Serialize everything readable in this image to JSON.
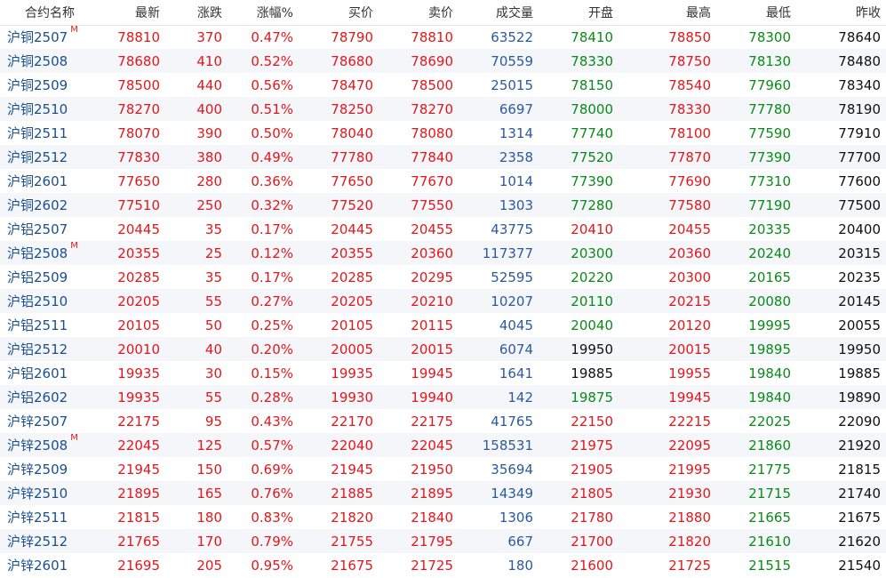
{
  "colors": {
    "up": "#e5161b",
    "down": "#098b17",
    "flat": "#111111",
    "volume": "#2b5a9c",
    "name": "#1a4f8f",
    "main_mark": "#e02020",
    "row_stripe": "#f4f6fa"
  },
  "headers": [
    "合约名称",
    "最新",
    "涨跌",
    "涨幅%",
    "买价",
    "卖价",
    "成交量",
    "开盘",
    "最高",
    "最低",
    "昨收"
  ],
  "rows": [
    {
      "name": "沪铜2507",
      "main": "M",
      "last": "78810",
      "chg": "370",
      "pct": "0.47%",
      "bid": "78790",
      "ask": "78810",
      "vol": "63522",
      "open": "78410",
      "high": "78850",
      "low": "78300",
      "prev": "78640"
    },
    {
      "name": "沪铜2508",
      "main": "",
      "last": "78680",
      "chg": "410",
      "pct": "0.52%",
      "bid": "78680",
      "ask": "78690",
      "vol": "70559",
      "open": "78330",
      "high": "78750",
      "low": "78130",
      "prev": "78480"
    },
    {
      "name": "沪铜2509",
      "main": "",
      "last": "78500",
      "chg": "440",
      "pct": "0.56%",
      "bid": "78470",
      "ask": "78500",
      "vol": "25015",
      "open": "78150",
      "high": "78540",
      "low": "77960",
      "prev": "78340"
    },
    {
      "name": "沪铜2510",
      "main": "",
      "last": "78270",
      "chg": "400",
      "pct": "0.51%",
      "bid": "78250",
      "ask": "78270",
      "vol": "6697",
      "open": "78000",
      "high": "78330",
      "low": "77780",
      "prev": "78190"
    },
    {
      "name": "沪铜2511",
      "main": "",
      "last": "78070",
      "chg": "390",
      "pct": "0.50%",
      "bid": "78040",
      "ask": "78080",
      "vol": "1314",
      "open": "77740",
      "high": "78100",
      "low": "77590",
      "prev": "77910"
    },
    {
      "name": "沪铜2512",
      "main": "",
      "last": "77830",
      "chg": "380",
      "pct": "0.49%",
      "bid": "77780",
      "ask": "77840",
      "vol": "2358",
      "open": "77520",
      "high": "77870",
      "low": "77390",
      "prev": "77700"
    },
    {
      "name": "沪铜2601",
      "main": "",
      "last": "77650",
      "chg": "280",
      "pct": "0.36%",
      "bid": "77650",
      "ask": "77670",
      "vol": "1014",
      "open": "77390",
      "high": "77690",
      "low": "77310",
      "prev": "77600"
    },
    {
      "name": "沪铜2602",
      "main": "",
      "last": "77510",
      "chg": "250",
      "pct": "0.32%",
      "bid": "77520",
      "ask": "77550",
      "vol": "1303",
      "open": "77280",
      "high": "77580",
      "low": "77190",
      "prev": "77500"
    },
    {
      "name": "沪铝2507",
      "main": "",
      "last": "20445",
      "chg": "35",
      "pct": "0.17%",
      "bid": "20445",
      "ask": "20455",
      "vol": "43775",
      "open": "20410",
      "high": "20455",
      "low": "20335",
      "prev": "20400"
    },
    {
      "name": "沪铝2508",
      "main": "M",
      "last": "20355",
      "chg": "25",
      "pct": "0.12%",
      "bid": "20355",
      "ask": "20360",
      "vol": "117377",
      "open": "20300",
      "high": "20360",
      "low": "20240",
      "prev": "20315"
    },
    {
      "name": "沪铝2509",
      "main": "",
      "last": "20285",
      "chg": "35",
      "pct": "0.17%",
      "bid": "20285",
      "ask": "20295",
      "vol": "52595",
      "open": "20220",
      "high": "20300",
      "low": "20165",
      "prev": "20235"
    },
    {
      "name": "沪铝2510",
      "main": "",
      "last": "20205",
      "chg": "55",
      "pct": "0.27%",
      "bid": "20205",
      "ask": "20210",
      "vol": "10207",
      "open": "20110",
      "high": "20215",
      "low": "20080",
      "prev": "20145"
    },
    {
      "name": "沪铝2511",
      "main": "",
      "last": "20105",
      "chg": "50",
      "pct": "0.25%",
      "bid": "20105",
      "ask": "20115",
      "vol": "4045",
      "open": "20040",
      "high": "20120",
      "low": "19995",
      "prev": "20055"
    },
    {
      "name": "沪铝2512",
      "main": "",
      "last": "20010",
      "chg": "40",
      "pct": "0.20%",
      "bid": "20005",
      "ask": "20015",
      "vol": "6074",
      "open": "19950",
      "high": "20015",
      "low": "19895",
      "prev": "19950"
    },
    {
      "name": "沪铝2601",
      "main": "",
      "last": "19935",
      "chg": "30",
      "pct": "0.15%",
      "bid": "19935",
      "ask": "19945",
      "vol": "1641",
      "open": "19885",
      "high": "19955",
      "low": "19840",
      "prev": "19885"
    },
    {
      "name": "沪铝2602",
      "main": "",
      "last": "19935",
      "chg": "55",
      "pct": "0.28%",
      "bid": "19930",
      "ask": "19940",
      "vol": "142",
      "open": "19875",
      "high": "19945",
      "low": "19840",
      "prev": "19890"
    },
    {
      "name": "沪锌2507",
      "main": "",
      "last": "22175",
      "chg": "95",
      "pct": "0.43%",
      "bid": "22170",
      "ask": "22175",
      "vol": "41765",
      "open": "22150",
      "high": "22215",
      "low": "22025",
      "prev": "22090"
    },
    {
      "name": "沪锌2508",
      "main": "M",
      "last": "22045",
      "chg": "125",
      "pct": "0.57%",
      "bid": "22040",
      "ask": "22045",
      "vol": "158531",
      "open": "21975",
      "high": "22095",
      "low": "21860",
      "prev": "21920"
    },
    {
      "name": "沪锌2509",
      "main": "",
      "last": "21945",
      "chg": "150",
      "pct": "0.69%",
      "bid": "21945",
      "ask": "21950",
      "vol": "35694",
      "open": "21905",
      "high": "21995",
      "low": "21775",
      "prev": "21815"
    },
    {
      "name": "沪锌2510",
      "main": "",
      "last": "21895",
      "chg": "165",
      "pct": "0.76%",
      "bid": "21885",
      "ask": "21895",
      "vol": "14349",
      "open": "21805",
      "high": "21930",
      "low": "21715",
      "prev": "21740"
    },
    {
      "name": "沪锌2511",
      "main": "",
      "last": "21815",
      "chg": "180",
      "pct": "0.83%",
      "bid": "21820",
      "ask": "21840",
      "vol": "1306",
      "open": "21780",
      "high": "21880",
      "low": "21665",
      "prev": "21675"
    },
    {
      "name": "沪锌2512",
      "main": "",
      "last": "21765",
      "chg": "170",
      "pct": "0.79%",
      "bid": "21755",
      "ask": "21795",
      "vol": "667",
      "open": "21700",
      "high": "21820",
      "low": "21610",
      "prev": "21620"
    },
    {
      "name": "沪锌2601",
      "main": "",
      "last": "21695",
      "chg": "205",
      "pct": "0.95%",
      "bid": "21675",
      "ask": "21725",
      "vol": "180",
      "open": "21600",
      "high": "21725",
      "low": "21515",
      "prev": "21540"
    }
  ]
}
